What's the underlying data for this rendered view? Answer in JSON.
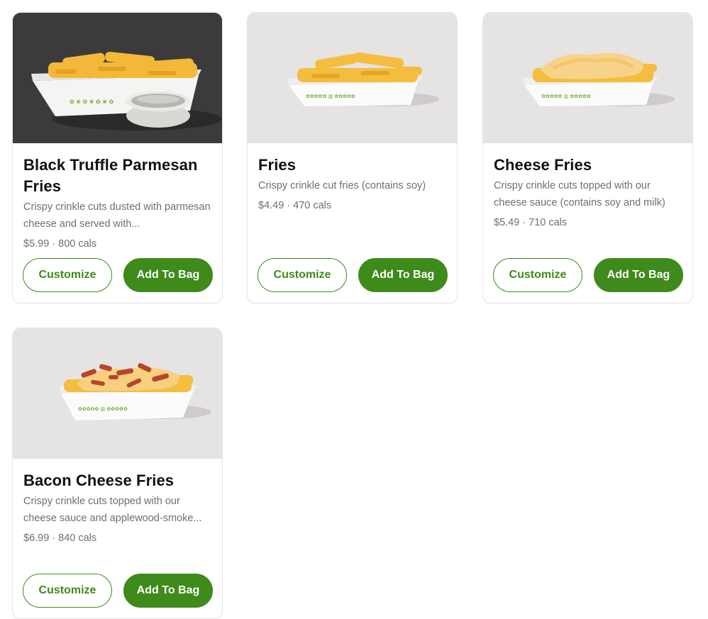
{
  "colors": {
    "brand_green": "#3e8a1a",
    "card_border": "#e8e6e6",
    "muted_text": "#6f6f6f"
  },
  "menu_items": [
    {
      "title": "Black Truffle Parmesan Fries",
      "description": "Crispy crinkle cuts dusted with parmesan cheese and served with...",
      "price": "$5.99",
      "calories": "800 cals",
      "customize_label": "Customize",
      "add_label": "Add To Bag",
      "image": "fries-with-truffle-dip-photo"
    },
    {
      "title": "Fries",
      "description": "Crispy crinkle cut fries (contains soy)",
      "price": "$4.49",
      "calories": "470 cals",
      "customize_label": "Customize",
      "add_label": "Add To Bag",
      "image": "fries-photo"
    },
    {
      "title": "Cheese Fries",
      "description": "Crispy crinkle cuts topped with our cheese sauce (contains soy and milk)",
      "price": "$5.49",
      "calories": "710 cals",
      "customize_label": "Customize",
      "add_label": "Add To Bag",
      "image": "cheese-fries-photo"
    },
    {
      "title": "Bacon Cheese Fries",
      "description": "Crispy crinkle cuts topped with our cheese sauce and applewood-smoke...",
      "price": "$6.99",
      "calories": "840 cals",
      "customize_label": "Customize",
      "add_label": "Add To Bag",
      "image": "bacon-cheese-fries-photo"
    }
  ],
  "separator": "·"
}
